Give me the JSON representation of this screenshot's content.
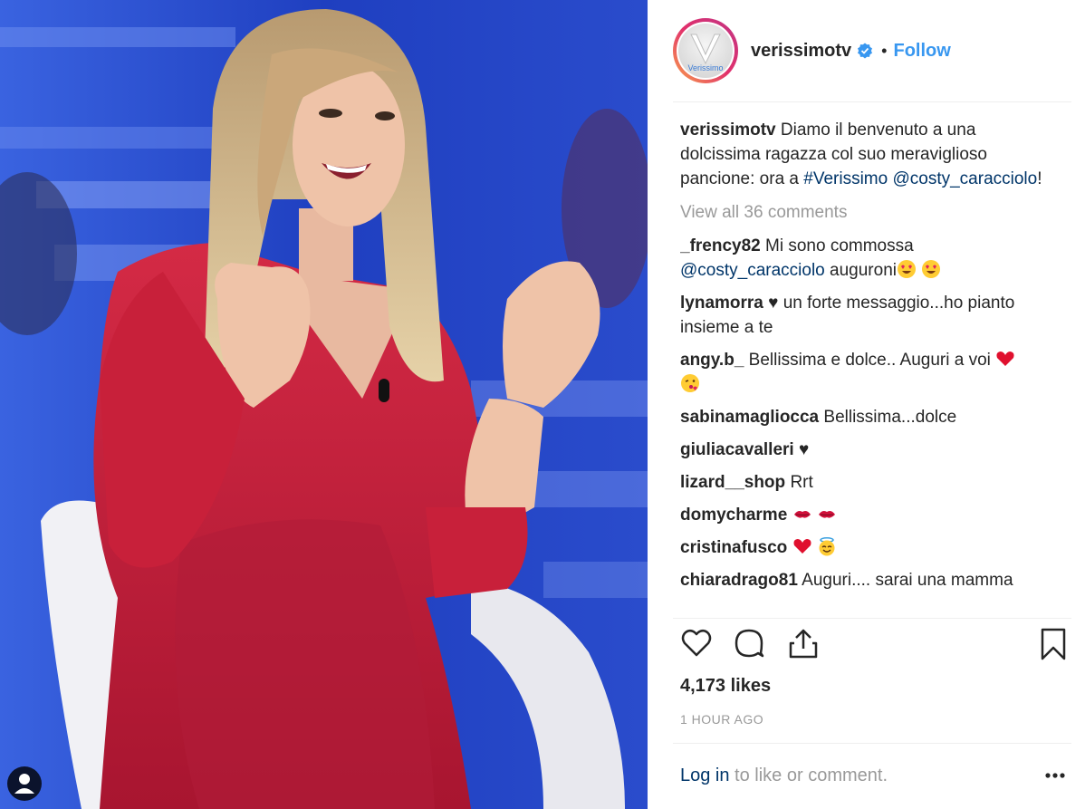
{
  "post": {
    "username": "verissimotv",
    "avatar_text": "Verissimo",
    "dot": "•",
    "follow_label": "Follow",
    "caption": {
      "user": "verissimotv",
      "text": "Diamo il benvenuto a una dolcissima ragazza col suo meraviglioso pancione: ora a ",
      "hashtag": "#Verissimo",
      "mention": "@costy_caracciolo",
      "end": "!"
    },
    "view_all": "View all 36 comments",
    "comments": [
      {
        "user": "_frency82",
        "text": "Mi sono commossa ",
        "mention": "@costy_caracciolo",
        "after": " auguroni",
        "emojis": [
          "heart-eyes-emoji",
          "heart-eyes-emoji"
        ]
      },
      {
        "user": "lynamorra",
        "text": "♥ un forte messaggio...ho pianto insieme a te"
      },
      {
        "user": "angy.b_",
        "text": "Bellissima e dolce.. Auguri a voi ",
        "emojis": [
          "red-heart-emoji",
          "kiss-face-emoji"
        ]
      },
      {
        "user": "sabinamagliocca",
        "text": "Bellissima...dolce"
      },
      {
        "user": "giuliacavalleri",
        "text": "♥"
      },
      {
        "user": "lizard__shop",
        "text": "Rrt"
      },
      {
        "user": "domycharme",
        "text": "",
        "emojis": [
          "kiss-lips-emoji",
          "kiss-lips-emoji"
        ]
      },
      {
        "user": "cristinafusco",
        "text": "",
        "emojis": [
          "red-heart-emoji",
          "angel-face-emoji"
        ]
      },
      {
        "user": "chiaradrago81",
        "text": "Auguri.... sarai una mamma"
      }
    ],
    "likes": "4,173 likes",
    "time": "1 HOUR AGO",
    "login_link": "Log in",
    "login_rest": " to like or comment."
  },
  "icons": {
    "like": "heart-outline-icon",
    "comment": "speech-bubble-icon",
    "share": "share-upload-icon",
    "save": "bookmark-icon",
    "more": "more-dots-icon",
    "tag": "person-tag-icon",
    "verified": "verified-badge-icon"
  },
  "colors": {
    "follow": "#3897f0",
    "link": "#003569",
    "muted": "#999999",
    "dress": "#c8203a",
    "backdrop": "#1d3fb5"
  }
}
